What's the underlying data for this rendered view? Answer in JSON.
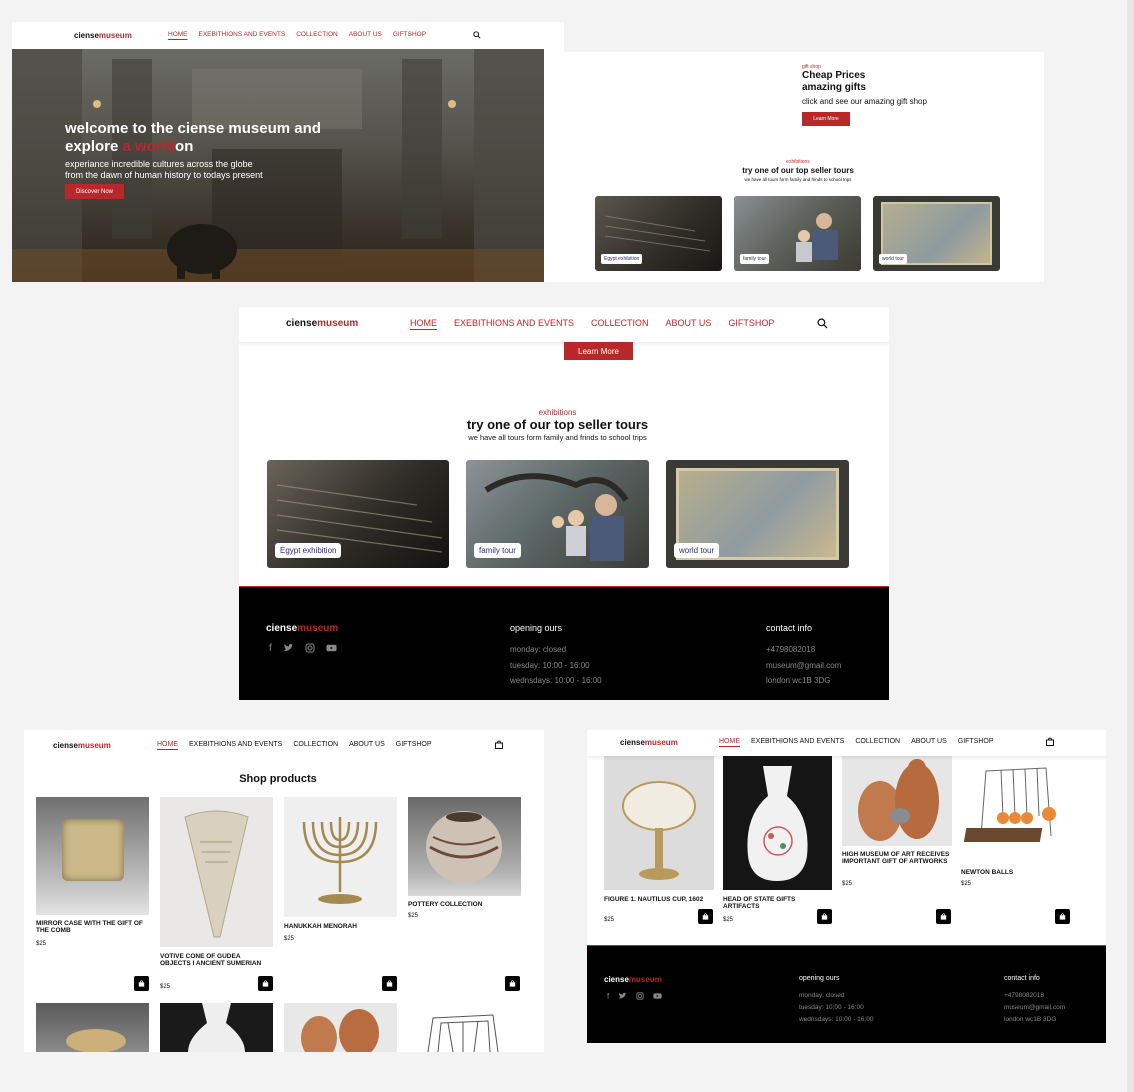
{
  "brand": {
    "part1": "ciense",
    "part2": "museum"
  },
  "nav": {
    "home": "HOME",
    "events": "EXEBITHIONS AND EVENTS",
    "collection": "COLLECTION",
    "about": "ABOUT US",
    "giftshop": "GIFTSHOP"
  },
  "hero": {
    "line1": "welcome to the ciense museum and",
    "line2_start": "explore ",
    "line2_highlight": "a world",
    "line2_end": "on",
    "sub1": "experiance incredible cultures across the globe",
    "sub2": "from the dawn of human history to todays present",
    "cta": "Discover Now"
  },
  "giftshop": {
    "eyebrow": "gift shop",
    "title1": "Cheap Prices",
    "title2": "amazing gifts",
    "text": "click and see our amazing gift shop",
    "cta": "Learn More"
  },
  "tours": {
    "eyebrow": "exhibitions",
    "title": "try one of our top seller tours",
    "sub": "we have all tours form family and frinds to school trips",
    "items": [
      {
        "label": "Egypt exhibition"
      },
      {
        "label": "family tour"
      },
      {
        "label": "world tour"
      }
    ]
  },
  "footer": {
    "opening_title": "opening ours",
    "opening": [
      "monday: closed",
      "tuesday: 10:00 - 16:00",
      "wednsdays: 10:00 - 16:00"
    ],
    "contact_title": "contact info",
    "contact": [
      "+4798082018",
      "museum@gmail.com",
      "london wc1B 3DG"
    ]
  },
  "shop": {
    "title": "Shop products",
    "products": [
      {
        "name": "MIRROR CASE WITH THE GIFT OF THE COMB",
        "price": "$25"
      },
      {
        "name": "VOTIVE CONE OF GUDEA OBJECTS I ANCIENT SUMERIAN",
        "price": "$25"
      },
      {
        "name": "HANUKKAH MENORAH",
        "price": "$25"
      },
      {
        "name": "POTTERY COLLECTION",
        "price": "$25"
      }
    ],
    "products2": [
      {
        "name": "FIGURE 1. NAUTILUS CUP, 1602",
        "price": "$25"
      },
      {
        "name": "HEAD OF STATE GIFTS ARTIFACTS",
        "price": "$25"
      },
      {
        "name": "HIGH MUSEUM OF ART RECEIVES IMPORTANT GIFT OF ARTWORKS",
        "price": "$25"
      },
      {
        "name": "NEWTON BALLS",
        "price": "$25"
      }
    ]
  },
  "colors": {
    "accent": "#b8282b",
    "footer_bg": "#000000"
  },
  "icons": [
    "search-icon",
    "bag-icon",
    "facebook-icon",
    "twitter-icon",
    "instagram-icon",
    "youtube-icon"
  ]
}
